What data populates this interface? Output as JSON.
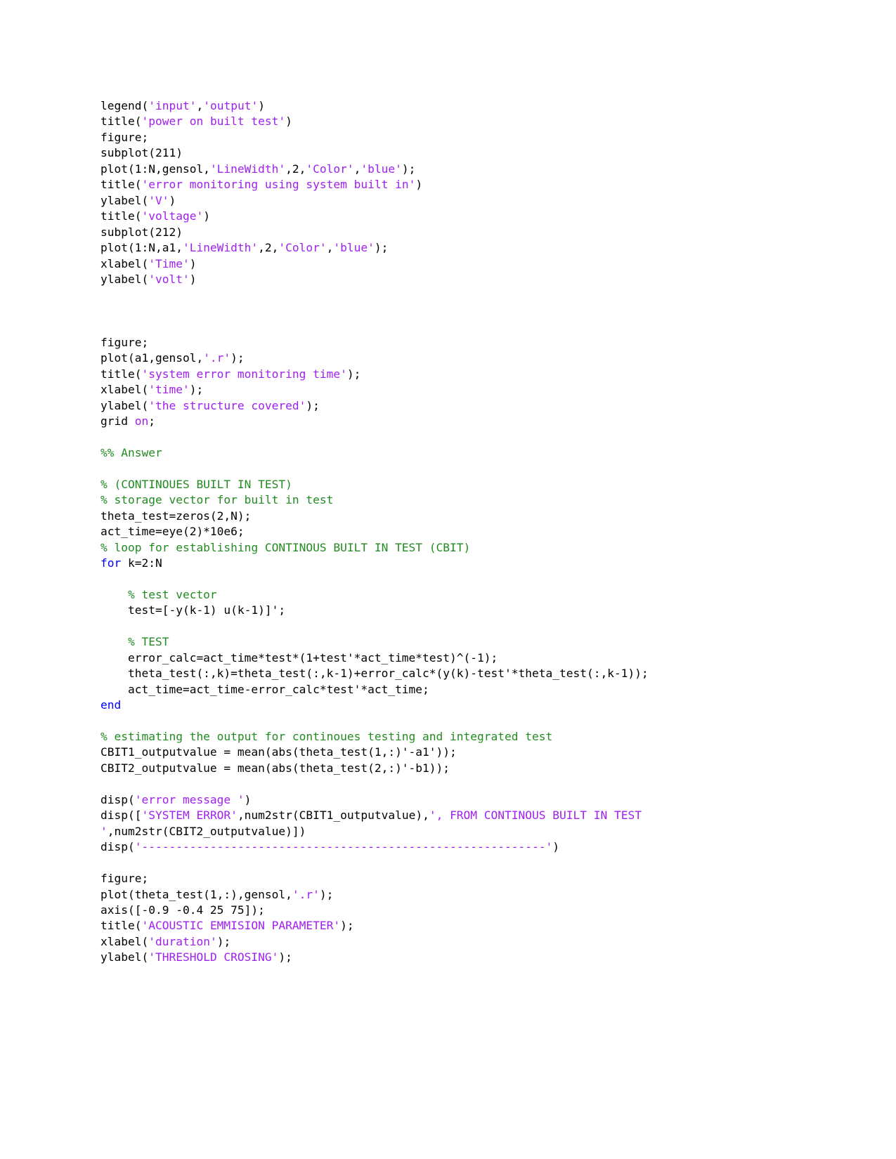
{
  "document": {
    "type": "matlab-code-listing",
    "page_background": "#ffffff",
    "syntax_colors": {
      "plain": "#000000",
      "string": "#a020f0",
      "comment": "#228b22",
      "keyword": "#0000ff"
    },
    "lines": [
      {
        "id": "line-1",
        "tokens": [
          {
            "t": "plain",
            "v": "legend("
          },
          {
            "t": "string",
            "v": "'input'"
          },
          {
            "t": "plain",
            "v": ","
          },
          {
            "t": "string",
            "v": "'output'"
          },
          {
            "t": "plain",
            "v": ")"
          }
        ]
      },
      {
        "id": "line-2",
        "tokens": [
          {
            "t": "plain",
            "v": "title("
          },
          {
            "t": "string",
            "v": "'power on built test'"
          },
          {
            "t": "plain",
            "v": ")"
          }
        ]
      },
      {
        "id": "line-3",
        "tokens": [
          {
            "t": "plain",
            "v": "figure;"
          }
        ]
      },
      {
        "id": "line-4",
        "tokens": [
          {
            "t": "plain",
            "v": "subplot(211)"
          }
        ]
      },
      {
        "id": "line-5",
        "tokens": [
          {
            "t": "plain",
            "v": "plot(1:N,gensol,"
          },
          {
            "t": "string",
            "v": "'LineWidth'"
          },
          {
            "t": "plain",
            "v": ",2,"
          },
          {
            "t": "string",
            "v": "'Color'"
          },
          {
            "t": "plain",
            "v": ","
          },
          {
            "t": "string",
            "v": "'blue'"
          },
          {
            "t": "plain",
            "v": ");"
          }
        ]
      },
      {
        "id": "line-6",
        "tokens": [
          {
            "t": "plain",
            "v": "title("
          },
          {
            "t": "string",
            "v": "'error monitoring using system built in'"
          },
          {
            "t": "plain",
            "v": ")"
          }
        ]
      },
      {
        "id": "line-7",
        "tokens": [
          {
            "t": "plain",
            "v": "ylabel("
          },
          {
            "t": "string",
            "v": "'V'"
          },
          {
            "t": "plain",
            "v": ")"
          }
        ]
      },
      {
        "id": "line-8",
        "tokens": [
          {
            "t": "plain",
            "v": "title("
          },
          {
            "t": "string",
            "v": "'voltage'"
          },
          {
            "t": "plain",
            "v": ")"
          }
        ]
      },
      {
        "id": "line-9",
        "tokens": [
          {
            "t": "plain",
            "v": "subplot(212)"
          }
        ]
      },
      {
        "id": "line-10",
        "tokens": [
          {
            "t": "plain",
            "v": "plot(1:N,a1,"
          },
          {
            "t": "string",
            "v": "'LineWidth'"
          },
          {
            "t": "plain",
            "v": ",2,"
          },
          {
            "t": "string",
            "v": "'Color'"
          },
          {
            "t": "plain",
            "v": ","
          },
          {
            "t": "string",
            "v": "'blue'"
          },
          {
            "t": "plain",
            "v": ");"
          }
        ]
      },
      {
        "id": "line-11",
        "tokens": [
          {
            "t": "plain",
            "v": "xlabel("
          },
          {
            "t": "string",
            "v": "'Time'"
          },
          {
            "t": "plain",
            "v": ")"
          }
        ]
      },
      {
        "id": "line-12",
        "tokens": [
          {
            "t": "plain",
            "v": "ylabel("
          },
          {
            "t": "string",
            "v": "'volt'"
          },
          {
            "t": "plain",
            "v": ")"
          }
        ]
      },
      {
        "id": "line-13",
        "tokens": []
      },
      {
        "id": "line-14",
        "tokens": []
      },
      {
        "id": "line-15",
        "tokens": []
      },
      {
        "id": "line-16",
        "tokens": [
          {
            "t": "plain",
            "v": "figure;"
          }
        ]
      },
      {
        "id": "line-17",
        "tokens": [
          {
            "t": "plain",
            "v": "plot(a1,gensol,"
          },
          {
            "t": "string",
            "v": "'.r'"
          },
          {
            "t": "plain",
            "v": ");"
          }
        ]
      },
      {
        "id": "line-18",
        "tokens": [
          {
            "t": "plain",
            "v": "title("
          },
          {
            "t": "string",
            "v": "'system error monitoring time'"
          },
          {
            "t": "plain",
            "v": ");"
          }
        ]
      },
      {
        "id": "line-19",
        "tokens": [
          {
            "t": "plain",
            "v": "xlabel("
          },
          {
            "t": "string",
            "v": "'time'"
          },
          {
            "t": "plain",
            "v": ");"
          }
        ]
      },
      {
        "id": "line-20",
        "tokens": [
          {
            "t": "plain",
            "v": "ylabel("
          },
          {
            "t": "string",
            "v": "'the structure covered'"
          },
          {
            "t": "plain",
            "v": ");"
          }
        ]
      },
      {
        "id": "line-21",
        "tokens": [
          {
            "t": "plain",
            "v": "grid "
          },
          {
            "t": "string",
            "v": "on"
          },
          {
            "t": "plain",
            "v": ";"
          }
        ]
      },
      {
        "id": "line-22",
        "tokens": []
      },
      {
        "id": "line-23",
        "tokens": [
          {
            "t": "comment",
            "v": "%% Answer"
          }
        ]
      },
      {
        "id": "line-24",
        "tokens": []
      },
      {
        "id": "line-25",
        "tokens": [
          {
            "t": "comment",
            "v": "% (CONTINOUES BUILT IN TEST)"
          }
        ]
      },
      {
        "id": "line-26",
        "tokens": [
          {
            "t": "comment",
            "v": "% storage vector for built in test"
          }
        ]
      },
      {
        "id": "line-27",
        "tokens": [
          {
            "t": "plain",
            "v": "theta_test=zeros(2,N);"
          }
        ]
      },
      {
        "id": "line-28",
        "tokens": [
          {
            "t": "plain",
            "v": "act_time=eye(2)*10e6;"
          }
        ]
      },
      {
        "id": "line-29",
        "tokens": [
          {
            "t": "comment",
            "v": "% loop for establishing CONTINOUS BUILT IN TEST (CBIT)"
          }
        ]
      },
      {
        "id": "line-30",
        "tokens": [
          {
            "t": "keyword",
            "v": "for"
          },
          {
            "t": "plain",
            "v": " k=2:N"
          }
        ]
      },
      {
        "id": "line-31",
        "tokens": []
      },
      {
        "id": "line-32",
        "tokens": [
          {
            "t": "comment",
            "v": "    % test vector"
          }
        ]
      },
      {
        "id": "line-33",
        "tokens": [
          {
            "t": "plain",
            "v": "    test=[-y(k-1) u(k-1)]';"
          }
        ]
      },
      {
        "id": "line-34",
        "tokens": []
      },
      {
        "id": "line-35",
        "tokens": [
          {
            "t": "comment",
            "v": "    % TEST"
          }
        ]
      },
      {
        "id": "line-36",
        "tokens": [
          {
            "t": "plain",
            "v": "    error_calc=act_time*test*(1+test'*act_time*test)^(-1);"
          }
        ]
      },
      {
        "id": "line-37",
        "tokens": [
          {
            "t": "plain",
            "v": "    theta_test(:,k)=theta_test(:,k-1)+error_calc*(y(k)-test'*theta_test(:,k-1));"
          }
        ]
      },
      {
        "id": "line-38",
        "tokens": [
          {
            "t": "plain",
            "v": "    act_time=act_time-error_calc*test'*act_time;"
          }
        ]
      },
      {
        "id": "line-39",
        "tokens": [
          {
            "t": "keyword",
            "v": "end"
          }
        ]
      },
      {
        "id": "line-40",
        "tokens": []
      },
      {
        "id": "line-41",
        "tokens": [
          {
            "t": "comment",
            "v": "% estimating the output for continoues testing and integrated test"
          }
        ]
      },
      {
        "id": "line-42",
        "tokens": [
          {
            "t": "plain",
            "v": "CBIT1_outputvalue = mean(abs(theta_test(1,:)'-a1'));"
          }
        ]
      },
      {
        "id": "line-43",
        "tokens": [
          {
            "t": "plain",
            "v": "CBIT2_outputvalue = mean(abs(theta_test(2,:)'-b1));"
          }
        ]
      },
      {
        "id": "line-44",
        "tokens": []
      },
      {
        "id": "line-45",
        "tokens": [
          {
            "t": "plain",
            "v": "disp("
          },
          {
            "t": "string",
            "v": "'error message '"
          },
          {
            "t": "plain",
            "v": ")"
          }
        ]
      },
      {
        "id": "line-46",
        "tokens": [
          {
            "t": "plain",
            "v": "disp(["
          },
          {
            "t": "string",
            "v": "'SYSTEM ERROR'"
          },
          {
            "t": "plain",
            "v": ",num2str(CBIT1_outputvalue),"
          },
          {
            "t": "string",
            "v": "', FROM CONTINOUS BUILT IN TEST '"
          },
          {
            "t": "plain",
            "v": ",num2str(CBIT2_outputvalue)])"
          }
        ]
      },
      {
        "id": "line-47",
        "tokens": [
          {
            "t": "plain",
            "v": "disp("
          },
          {
            "t": "string",
            "v": "'-----------------------------------------------------------'"
          },
          {
            "t": "plain",
            "v": ")"
          }
        ]
      },
      {
        "id": "line-48",
        "tokens": []
      },
      {
        "id": "line-49",
        "tokens": [
          {
            "t": "plain",
            "v": "figure;"
          }
        ]
      },
      {
        "id": "line-50",
        "tokens": [
          {
            "t": "plain",
            "v": "plot(theta_test(1,:),gensol,"
          },
          {
            "t": "string",
            "v": "'.r'"
          },
          {
            "t": "plain",
            "v": ");"
          }
        ]
      },
      {
        "id": "line-51",
        "tokens": [
          {
            "t": "plain",
            "v": "axis([-0.9 -0.4 25 75]);"
          }
        ]
      },
      {
        "id": "line-52",
        "tokens": [
          {
            "t": "plain",
            "v": "title("
          },
          {
            "t": "string",
            "v": "'ACOUSTIC EMMISION PARAMETER'"
          },
          {
            "t": "plain",
            "v": ");"
          }
        ]
      },
      {
        "id": "line-53",
        "tokens": [
          {
            "t": "plain",
            "v": "xlabel("
          },
          {
            "t": "string",
            "v": "'duration'"
          },
          {
            "t": "plain",
            "v": ");"
          }
        ]
      },
      {
        "id": "line-54",
        "tokens": [
          {
            "t": "plain",
            "v": "ylabel("
          },
          {
            "t": "string",
            "v": "'THRESHOLD CROSING'"
          },
          {
            "t": "plain",
            "v": ");"
          }
        ]
      }
    ]
  }
}
